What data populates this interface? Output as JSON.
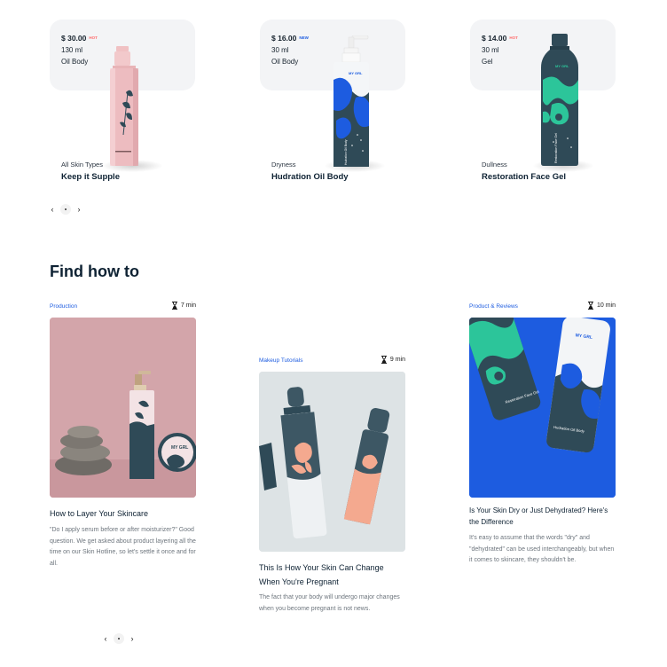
{
  "products": [
    {
      "price": "$ 30.00",
      "badge": "HOT",
      "badge_color": "#ff6b6b",
      "volume": "130 ml",
      "type": "Oil Body",
      "category": "All Skin Types",
      "name": "Keep it Supple"
    },
    {
      "price": "$ 16.00",
      "badge": "NEW",
      "badge_color": "#1d5ce0",
      "volume": "30 ml",
      "type": "Oil Body",
      "category": "Dryness",
      "name": "Hudration Oil Body",
      "bottle_text": "Hudration Oil Body",
      "bottle_logo": "MY GRL"
    },
    {
      "price": "$ 14.00",
      "badge": "HOT",
      "badge_color": "#ff6b6b",
      "volume": "30 ml",
      "type": "Gel",
      "category": "Dullness",
      "name": "Restoration Face Gel",
      "bottle_text": "Restoration Face Gel",
      "bottle_logo": "MY GRL"
    }
  ],
  "carousel": {
    "prev": "‹",
    "next": "›"
  },
  "section": {
    "title": "Find how to"
  },
  "articles": [
    {
      "tag": "Production",
      "read_time": "7 min",
      "title": "How to Layer Your Skincare",
      "excerpt": "\"Do I apply serum before or after moisturizer?\" Good question. We get asked about product layering all the time on our Skin Hotline, so let's settle it once and for all.",
      "thumb_logo": "MY GRL"
    },
    {
      "tag": "Makeup Tutorials",
      "read_time": "9 min",
      "title": "This Is How Your Skin Can Change When You're Pregnant",
      "excerpt": "The fact that your body will undergo major changes when you become pregnant is not news."
    },
    {
      "tag": "Product & Reviews",
      "read_time": "10 min",
      "title": "Is Your Skin Dry or Just Dehydrated? Here's the Difference",
      "excerpt": "It's easy to assume that the words \"dry\" and \"dehydrated\" can be used interchangeably, but when it comes to skincare, they shouldn't be.",
      "thumb_logo": "MY GRL",
      "thumb_text_1": "Restoration Face Gel",
      "thumb_text_2": "Hudration Oil Body"
    }
  ],
  "colors": {
    "navy": "#0e2233",
    "accent_blue": "#1d5ce0",
    "hot_red": "#ff6b6b",
    "card_bg": "#f3f4f6",
    "pink": "#d6a9ad",
    "teal": "#2cc59a",
    "dark_teal": "#2f4a57"
  }
}
